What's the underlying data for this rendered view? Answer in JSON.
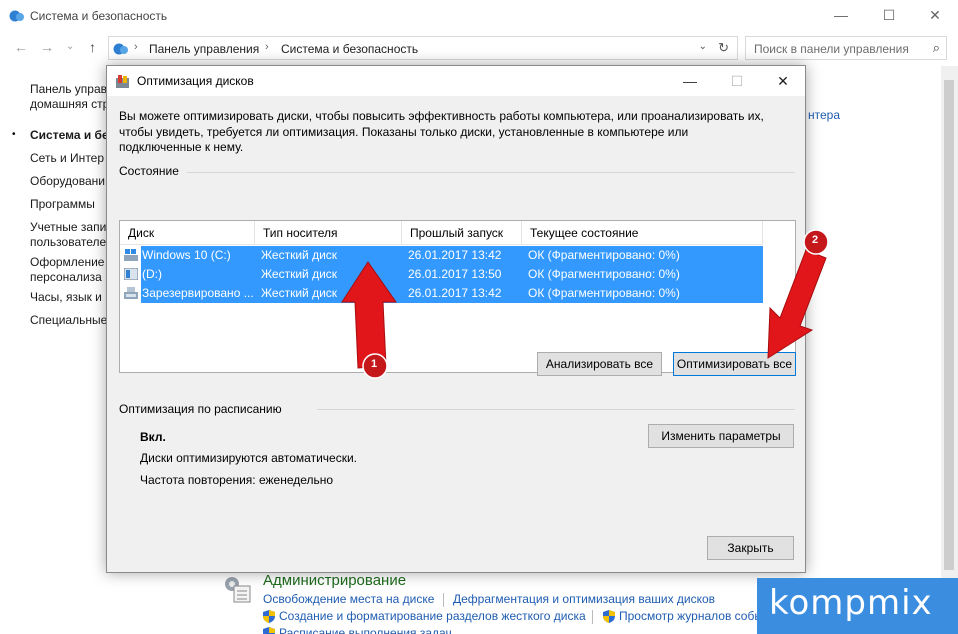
{
  "background_window": {
    "title": "Система и безопасность",
    "controls": {
      "minimize": "—",
      "maximize": "☐",
      "close": "✕"
    },
    "nav": {
      "back": "←",
      "forward": "→",
      "recent": "⌄",
      "up": "↑"
    },
    "breadcrumb": [
      "Панель управления",
      "Система и безопасность"
    ],
    "breadcrumb_sep": "›",
    "address_dropdown": "⌄",
    "refresh": "↻",
    "search_placeholder": "Поиск в панели управления",
    "search_icon": "⌕",
    "sidebar": {
      "bullet": "•",
      "home_line1": "Панель управ",
      "home_line2": "домашняя стр",
      "items": [
        "Система и бе",
        "Сеть и Интер",
        "Оборудовани",
        "Программы",
        "Учетные запи",
        "пользователе",
        "Оформление",
        "персонализа",
        "Часы, язык и р",
        "Специальные"
      ]
    },
    "right_link_fragment": "нтера",
    "admin": {
      "title": "Администрирование",
      "links": [
        "Освобождение места на диске",
        "Дефрагментация и оптимизация ваших дисков",
        "Создание и форматирование разделов жесткого диска",
        "Просмотр журналов событ"
      ],
      "cut_link": "Расписание выполнения задач"
    }
  },
  "dialog": {
    "title": "Оптимизация дисков",
    "controls": {
      "minimize": "—",
      "maximize": "☐",
      "close": "✕"
    },
    "intro_text": "Вы можете оптимизировать диски, чтобы повысить эффективность работы  компьютера, или проанализировать их, чтобы увидеть, требуется ли оптимизация. Показаны только диски, установленные в компьютере или подключенные к нему.",
    "status_label": "Состояние",
    "columns": [
      "Диск",
      "Тип носителя",
      "Прошлый запуск",
      "Текущее состояние"
    ],
    "drives": [
      {
        "name": "Windows 10 (C:)",
        "media": "Жесткий диск",
        "last_run": "26.01.2017 13:42",
        "status": "ОК (Фрагментировано: 0%)"
      },
      {
        "name": "(D:)",
        "media": "Жесткий диск",
        "last_run": "26.01.2017 13:50",
        "status": "ОК (Фрагментировано: 0%)"
      },
      {
        "name": "Зарезервировано ...",
        "media": "Жесткий диск",
        "last_run": "26.01.2017 13:42",
        "status": "ОК (Фрагментировано: 0%)"
      }
    ],
    "analyze_all_label": "Анализировать все",
    "optimize_all_label": "Оптимизировать все",
    "schedule_label": "Оптимизация по расписанию",
    "schedule_state": "Вкл.",
    "schedule_desc": "Диски оптимизируются автоматически.",
    "schedule_freq": "Частота повторения: еженедельно",
    "change_settings_label": "Изменить параметры",
    "close_label": "Закрыть"
  },
  "annotations": {
    "marker_1": "1",
    "marker_2": "2",
    "color": "#e0161b"
  },
  "watermark": "kompmix",
  "colors": {
    "selection": "#3399ff",
    "link": "#1f5cb0",
    "admin_title": "#1e6c1e",
    "watermark_bg": "#3b8de0"
  }
}
